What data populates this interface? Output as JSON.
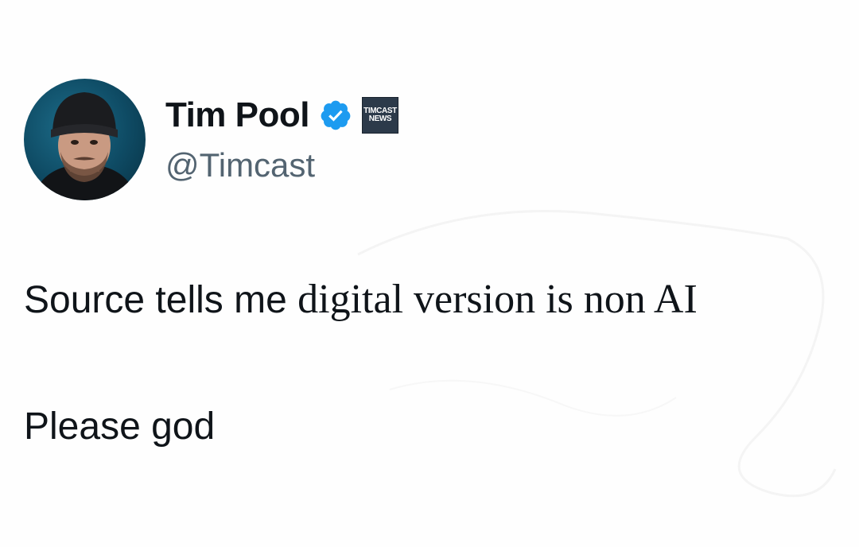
{
  "tweet": {
    "author": {
      "display_name": "Tim Pool",
      "handle": "@Timcast",
      "verified_icon": "verified-badge-icon",
      "affiliate_badge": {
        "line1": "TIMCAST",
        "line2": "NEWS"
      }
    },
    "text": {
      "line1_sans": "Source tells me ",
      "line1_serif": "digital version is non AI",
      "line2": "Please god"
    }
  },
  "colors": {
    "text": "#0f1419",
    "handle": "#536471",
    "verified": "#1d9bf0",
    "background": "#fefefe"
  }
}
